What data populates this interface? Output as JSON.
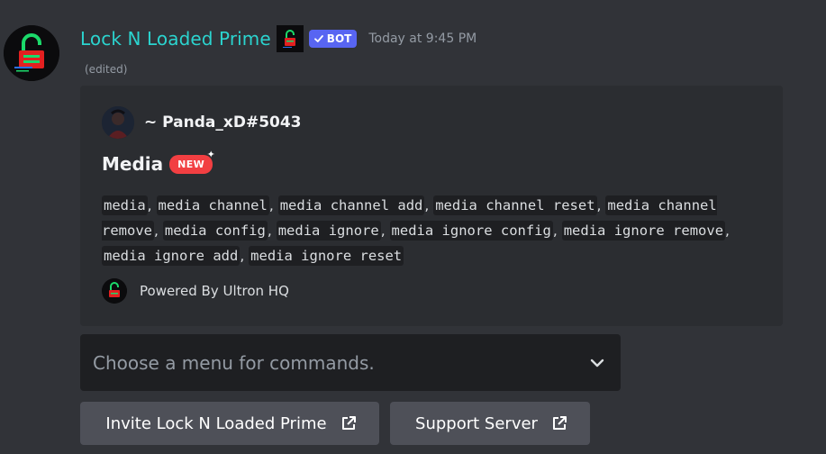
{
  "message": {
    "username": "Lock N Loaded Prime",
    "bot_badge": "BOT",
    "timestamp": "Today at 9:45 PM",
    "edited": "(edited)"
  },
  "embed": {
    "author": "~ Panda_xD#5043",
    "title": "Media",
    "new_badge": "NEW",
    "commands": [
      "media",
      "media channel",
      "media channel add",
      "media channel reset",
      "media channel remove",
      "media config",
      "media ignore",
      "media ignore config",
      "media ignore remove",
      "media ignore add",
      "media ignore reset"
    ],
    "separator": ", ",
    "footer": "Powered By Ultron HQ"
  },
  "select_menu": {
    "placeholder": "Choose a menu for commands."
  },
  "buttons": {
    "invite_label": "Invite Lock N Loaded Prime",
    "support_label": "Support Server"
  },
  "icons": {
    "verified_check": "check-icon",
    "chevron": "chevron-down-icon",
    "external_link": "external-link-icon",
    "sparkle": "sparkle-icon"
  },
  "colors": {
    "background": "#313338",
    "embed_bg": "#2b2d31",
    "username": "#2bd4cf",
    "bot_badge": "#5865f2",
    "new_badge": "#f23f42",
    "button_bg": "#4e5058",
    "select_bg": "#1e1f22"
  }
}
